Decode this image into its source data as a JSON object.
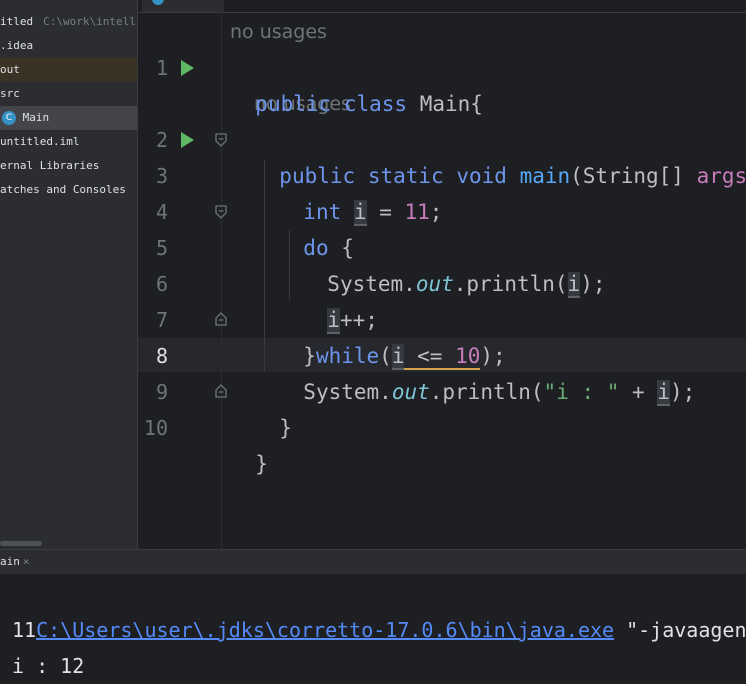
{
  "project": {
    "root_name": "itled",
    "root_path": "C:\\work\\intelliJ",
    "items": [
      {
        "label": ".idea"
      },
      {
        "label": "out"
      },
      {
        "label": "src"
      },
      {
        "label": "Main"
      },
      {
        "label": "untitled.iml"
      },
      {
        "label": "ernal Libraries"
      },
      {
        "label": "atches and Consoles"
      }
    ]
  },
  "editor": {
    "line_numbers": [
      "1",
      "2",
      "3",
      "4",
      "5",
      "6",
      "7",
      "8",
      "9",
      "10"
    ],
    "current_line": "8",
    "hints": {
      "usages_class": "no usages",
      "usages_main": "no usages"
    },
    "tokens": {
      "l1_public": "public",
      "l1_class": "class",
      "l1_name": "Main{",
      "l2_public": "public",
      "l2_static": "static",
      "l2_void": "void",
      "l2_main": "main",
      "l2_params": "(String[]",
      "l2_args": "args",
      "l2_end": "){",
      "l3_int": "int",
      "l3_i": "i",
      "l3_eq": " = ",
      "l3_num": "11",
      "l3_semi": ";",
      "l4_do": "do",
      "l4_brace": " {",
      "l5_system": "System.",
      "l5_out": "out",
      "l5_println": ".println(",
      "l5_i": "i",
      "l5_end": ");",
      "l6_i": "i",
      "l6_pp": "++;",
      "l7_brace": "}",
      "l7_while": "while",
      "l7_open": "(",
      "l7_i": "i",
      "l7_le": " <= ",
      "l7_num": "10",
      "l7_end": ");",
      "l8_system": "System.",
      "l8_out": "out",
      "l8_println": ".println(",
      "l8_str": "\"i : \"",
      "l8_plus": " + ",
      "l8_i": "i",
      "l8_end": ");",
      "l9_brace": "}",
      "l10_brace": "}"
    }
  },
  "run": {
    "tab_label": "ain",
    "tab_close": "×",
    "command_link": "C:\\Users\\user\\.jdks\\corretto-17.0.6\\bin\\java.exe",
    "command_rest": " \"-javaagent:C",
    "output": [
      "11",
      "i : 12"
    ]
  },
  "colors": {
    "background": "#1e1f22",
    "keyword": "#cf8e6d",
    "number": "#c77dbb",
    "link": "#548af7",
    "run_icon": "#5fb865"
  }
}
